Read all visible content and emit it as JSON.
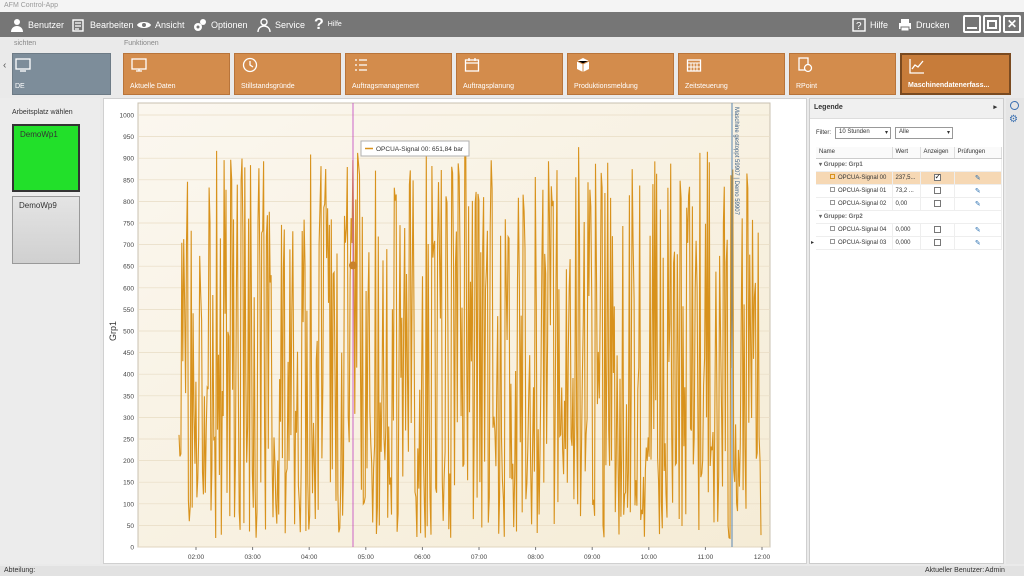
{
  "window": {
    "title": "AFM Control-App"
  },
  "menu": {
    "benutzer": "Benutzer",
    "bearbeiten": "Bearbeiten",
    "ansicht": "Ansicht",
    "optionen": "Optionen",
    "service": "Service",
    "hilfe_small": "Hilfe",
    "hilfe": "Hilfe",
    "drucken": "Drucken"
  },
  "sections": {
    "sichten": "sichten",
    "funktionen": "Funktionen"
  },
  "left_tile_label": "DE",
  "tiles": [
    {
      "label": "Aktuelle Daten",
      "icon": "monitor-icon"
    },
    {
      "label": "Stillstandsgründe",
      "icon": "clock-icon"
    },
    {
      "label": "Auftragsmanagement",
      "icon": "list-icon"
    },
    {
      "label": "Auftragsplanung",
      "icon": "calendar-icon"
    },
    {
      "label": "Produktionsmeldung",
      "icon": "box-icon"
    },
    {
      "label": "Zeitsteuerung",
      "icon": "calendar-grid-icon"
    },
    {
      "label": "RPoint",
      "icon": "gear-document-icon"
    },
    {
      "label": "Maschinendatenerfass...",
      "icon": "chart-line-icon"
    }
  ],
  "workplace": {
    "title": "Arbeitsplatz wählen",
    "items": [
      {
        "label": "DemoWp1",
        "color": "#22e02a"
      },
      {
        "label": "DemoWp9",
        "color": "#d0d0d0"
      }
    ]
  },
  "chart_data": {
    "type": "line",
    "ylabel": "Grp1",
    "ylim": [
      0,
      1000
    ],
    "yticks": [
      0,
      50,
      100,
      150,
      200,
      250,
      300,
      350,
      400,
      450,
      500,
      550,
      600,
      650,
      700,
      750,
      800,
      850,
      900,
      950,
      1000
    ],
    "xticks": [
      "02:00",
      "03:00",
      "04:00",
      "05:00",
      "06:00",
      "07:00",
      "08:00",
      "09:00",
      "10:00",
      "11:00",
      "12:00"
    ],
    "series": [
      {
        "name": "OPCUA-Signal 00",
        "color": "#d8921c"
      }
    ],
    "tooltip": "OPCUA-Signal 00: 651,84 bar",
    "marker_value": 651.84,
    "event_label": "Maschine gestoppt 59907 | Demo 59907",
    "series_color": "#d8921c",
    "cursor_color": "#c040c0",
    "event_line_color": "#5a86b0"
  },
  "legend": {
    "title": "Legende",
    "filter_label": "Filter:",
    "filter_value": "10 Stunden",
    "filter_all": "Alle",
    "columns": [
      "Name",
      "Wert",
      "Anzeigen",
      "Prüfungen"
    ],
    "groups": [
      {
        "name": "Gruppe: Grp1",
        "rows": [
          {
            "name": "OPCUA-Signal 00",
            "value": "237,5...",
            "show": true
          },
          {
            "name": "OPCUA-Signal 01",
            "value": "73,2 ...",
            "show": false
          },
          {
            "name": "OPCUA-Signal 02",
            "value": "0,00",
            "show": false
          }
        ]
      },
      {
        "name": "Gruppe: Grp2",
        "rows": [
          {
            "name": "OPCUA-Signal 04",
            "value": "0,000",
            "show": false
          },
          {
            "name": "OPCUA-Signal 03",
            "value": "0,000",
            "show": false
          }
        ]
      }
    ]
  },
  "status": {
    "abteilung": "Abteilung:",
    "user_label": "Aktueller Benutzer:",
    "user": "Admin"
  }
}
